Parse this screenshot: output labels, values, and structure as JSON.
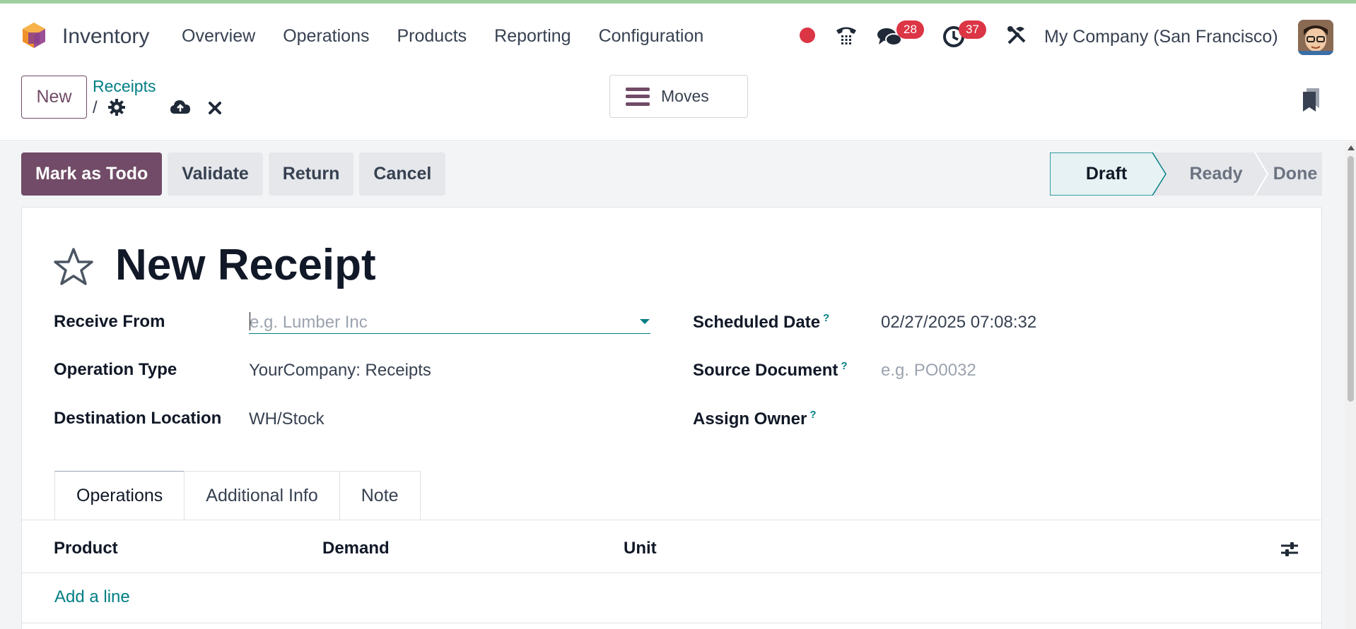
{
  "app": {
    "name": "Inventory",
    "menu": [
      "Overview",
      "Operations",
      "Products",
      "Reporting",
      "Configuration"
    ],
    "company": "My Company (San Francisco)",
    "messages_count": "28",
    "activities_count": "37",
    "brand_color": "#714b67",
    "accent_color": "#017e84"
  },
  "control": {
    "new_label": "New",
    "breadcrumb": "Receipts",
    "breadcrumb_sep": "/",
    "moves_label": "Moves"
  },
  "statusbar": {
    "buttons": [
      "Mark as Todo",
      "Validate",
      "Return",
      "Cancel"
    ],
    "stages": [
      "Draft",
      "Ready",
      "Done"
    ],
    "current_stage": "Draft"
  },
  "form": {
    "title": "New Receipt",
    "receive_from_label": "Receive From",
    "receive_from_placeholder": "e.g. Lumber Inc",
    "operation_type_label": "Operation Type",
    "operation_type_value": "YourCompany: Receipts",
    "destination_label": "Destination Location",
    "destination_value": "WH/Stock",
    "scheduled_date_label": "Scheduled Date",
    "scheduled_date_value": "02/27/2025 07:08:32",
    "source_document_label": "Source Document",
    "source_document_placeholder": "e.g. PO0032",
    "assign_owner_label": "Assign Owner",
    "help_mark": "?"
  },
  "tabs": [
    "Operations",
    "Additional Info",
    "Note"
  ],
  "table": {
    "columns": [
      "Product",
      "Demand",
      "Unit"
    ],
    "add_line": "Add a line"
  }
}
